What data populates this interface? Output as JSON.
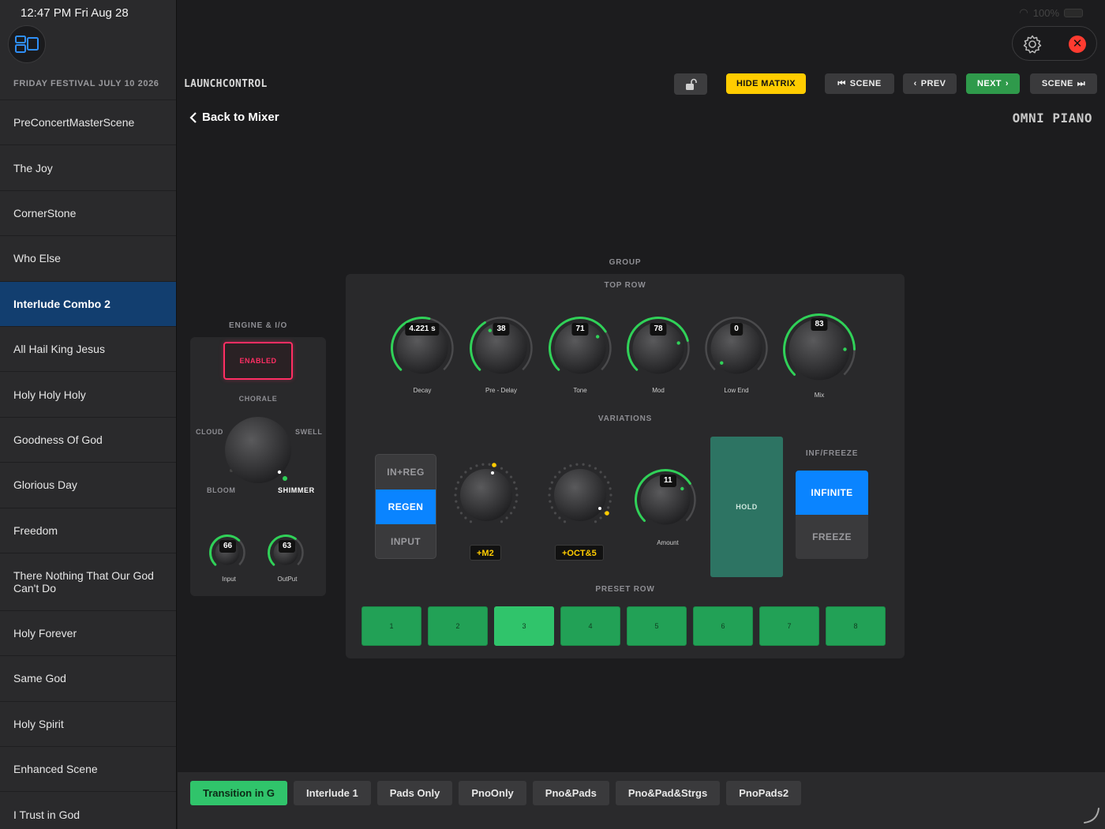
{
  "status": {
    "time": "12:47 PM  Fri Aug 28",
    "battery": "100%"
  },
  "sidebar": {
    "header": "FRIDAY FESTIVAL JULY 10 2026",
    "songs": [
      "PreConcertMasterScene",
      "The Joy",
      "CornerStone",
      "Who Else",
      "Interlude Combo 2",
      "All Hail King Jesus",
      "Holy Holy Holy",
      "Goodness Of God",
      "Glorious Day",
      "Freedom",
      "There Nothing That Our God Can't Do",
      "Holy Forever",
      "Same God",
      "Holy Spirit",
      "Enhanced Scene",
      "I Trust in God"
    ],
    "active_index": 4
  },
  "header": {
    "title": "LAUNCHCONTROL",
    "hide_matrix": "HIDE MATRIX",
    "scene_prev": "SCENE",
    "prev": "PREV",
    "next": "NEXT",
    "scene_next": "SCENE",
    "back": "Back to Mixer",
    "instrument": "OMNI PIANO"
  },
  "engine": {
    "section": "ENGINE & I/O",
    "enabled": "ENABLED",
    "chorale": "CHORALE",
    "cloud": "CLOUD",
    "swell": "SWELL",
    "bloom": "BLOOM",
    "shimmer": "SHIMMER",
    "input_label": "Input",
    "input_value": "66",
    "output_label": "OutPut",
    "output_value": "63"
  },
  "group": {
    "section": "GROUP",
    "top_row": "TOP ROW",
    "variations": "VARIATIONS",
    "preset_row": "PRESET ROW",
    "knobs": [
      {
        "label": "Decay",
        "value": "4.221 s",
        "level": 0.55
      },
      {
        "label": "Pre - Delay",
        "value": "38",
        "level": 0.38
      },
      {
        "label": "Tone",
        "value": "71",
        "level": 0.71
      },
      {
        "label": "Mod",
        "value": "78",
        "level": 0.78
      },
      {
        "label": "Low End",
        "value": "0",
        "level": 0.0
      },
      {
        "label": "Mix",
        "value": "83",
        "level": 0.83
      }
    ],
    "routing": {
      "options": [
        "IN+REG",
        "REGEN",
        "INPUT"
      ],
      "active": 1
    },
    "pitch1": "+M2",
    "pitch2": "+OCT&5",
    "amount_label": "Amount",
    "amount_value": "11",
    "hold": "HOLD",
    "inf_freeze": "INF/FREEZE",
    "infinite": "INFINITE",
    "freeze": "FREEZE",
    "presets": [
      "1",
      "2",
      "3",
      "4",
      "5",
      "6",
      "7",
      "8"
    ],
    "active_preset": 2
  },
  "scenes": {
    "tabs": [
      "Transition in G",
      "Interlude 1",
      "Pads Only",
      "PnoOnly",
      "Pno&Pads",
      "Pno&Pad&Strgs",
      "PnoPads2"
    ],
    "active": 0
  },
  "colors": {
    "accent_green": "#30c46b",
    "accent_blue": "#0a84ff",
    "accent_yellow": "#ffcc00",
    "active_song": "#123e6f",
    "enabled_red": "#ff2e63"
  }
}
